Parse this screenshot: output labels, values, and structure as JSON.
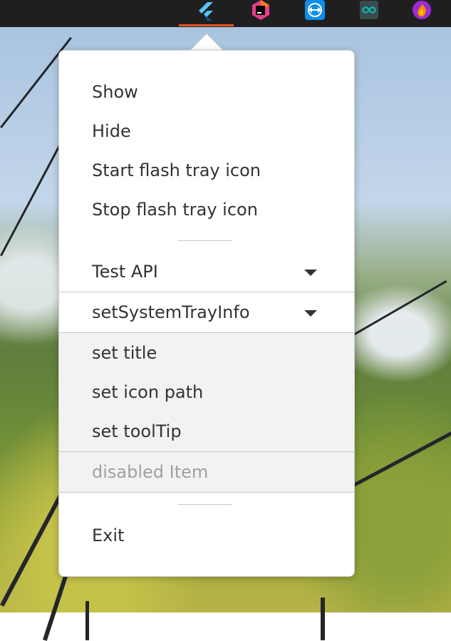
{
  "tray": {
    "icons": [
      {
        "name": "flutter-icon",
        "color": "#54c5f8"
      },
      {
        "name": "jetbrains-toolbox-icon",
        "color": "#e83e8c"
      },
      {
        "name": "teamviewer-icon",
        "color": "#0e8ee9"
      },
      {
        "name": "arduino-icon",
        "color": "#00979c"
      },
      {
        "name": "app-flame-icon",
        "color": "#9b2bd1"
      }
    ],
    "accent": "#e95420"
  },
  "menu": {
    "show": "Show",
    "hide": "Hide",
    "start_flash": "Start flash tray icon",
    "stop_flash": "Stop flash tray icon",
    "test_api": "Test API",
    "set_system_tray_info": "setSystemTrayInfo",
    "set_title": "set title",
    "set_icon_path": "set icon path",
    "set_tooltip": "set toolTip",
    "disabled_item": "disabled Item",
    "exit": "Exit"
  }
}
